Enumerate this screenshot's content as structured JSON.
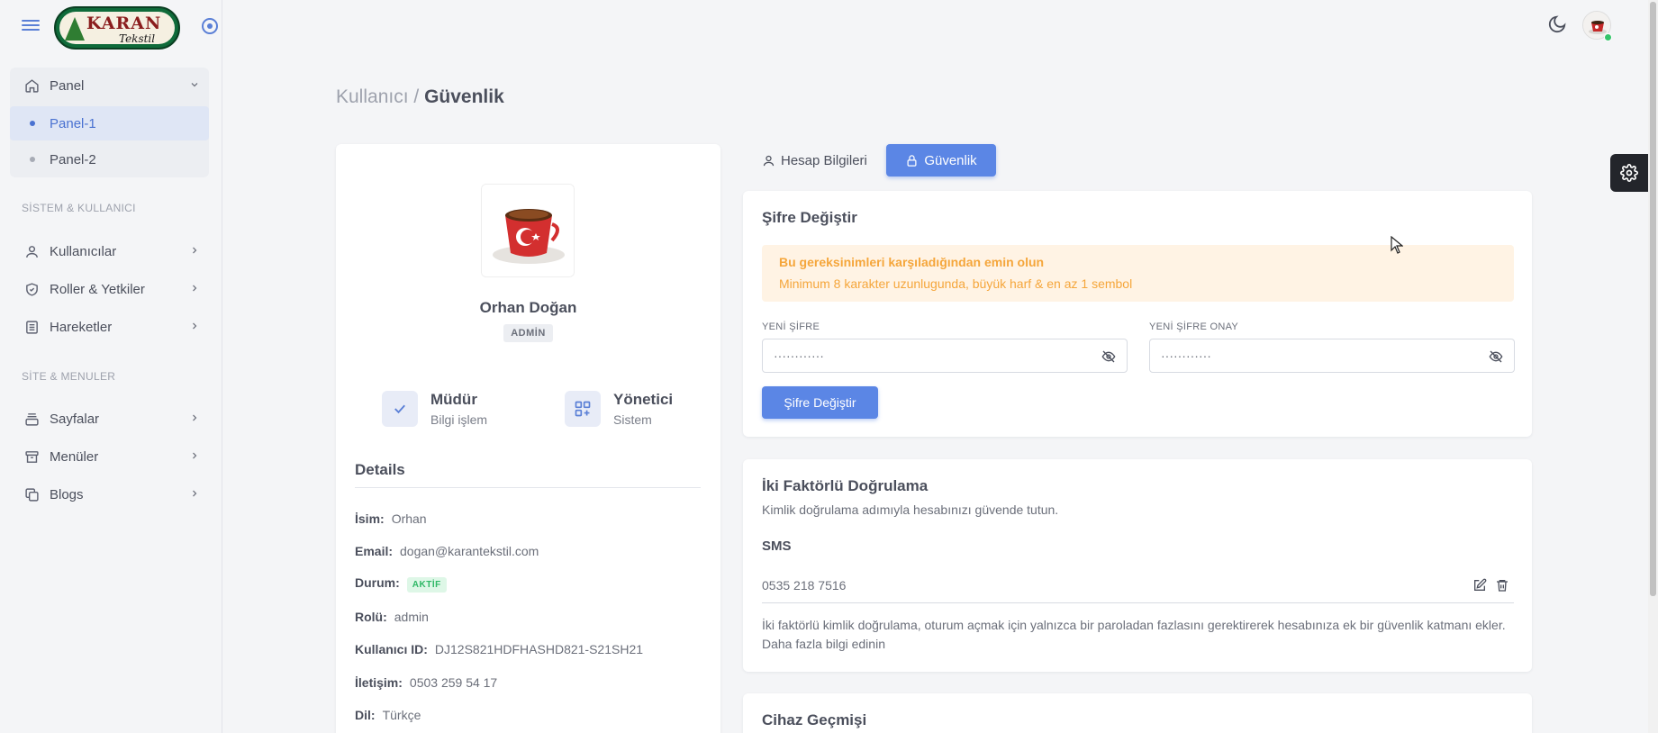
{
  "brand": {
    "logo_text": "KARAN",
    "logo_sub": "Tekstil"
  },
  "sidebar": {
    "panel": {
      "label": "Panel",
      "icon": "home-icon"
    },
    "panel_items": [
      {
        "label": "Panel-1",
        "active": true
      },
      {
        "label": "Panel-2",
        "active": false
      }
    ],
    "section_users": "SİSTEM & KULLANICI",
    "user_items": [
      {
        "label": "Kullanıcılar",
        "icon": "user-icon"
      },
      {
        "label": "Roller & Yetkiler",
        "icon": "shield-icon"
      },
      {
        "label": "Hareketler",
        "icon": "list-icon"
      }
    ],
    "section_site": "SİTE & MENULER",
    "site_items": [
      {
        "label": "Sayfalar",
        "icon": "layers-icon"
      },
      {
        "label": "Menüler",
        "icon": "archive-icon"
      },
      {
        "label": "Blogs",
        "icon": "copy-icon"
      }
    ]
  },
  "breadcrumb": {
    "parent": "Kullanıcı /",
    "current": "Güvenlik"
  },
  "profile": {
    "name": "Orhan Doğan",
    "role_badge": "ADMİN",
    "stats": [
      {
        "title": "Müdür",
        "sub": "Bilgi işlem",
        "icon": "check-icon"
      },
      {
        "title": "Yönetici",
        "sub": "Sistem",
        "icon": "grid-plus-icon"
      }
    ],
    "details_title": "Details",
    "details": [
      {
        "label": "İsim:",
        "value": "Orhan"
      },
      {
        "label": "Email:",
        "value": "dogan@karantekstil.com"
      },
      {
        "label": "Durum:",
        "value": "AKTİF"
      },
      {
        "label": "Rolü:",
        "value": "admin"
      },
      {
        "label": "Kullanıcı ID:",
        "value": "DJ12S821HDFHASHD821-S21SH21"
      },
      {
        "label": "İletişim:",
        "value": "0503 259 54 17"
      },
      {
        "label": "Dil:",
        "value": "Türkçe"
      }
    ]
  },
  "tabs": {
    "account": "Hesap Bilgileri",
    "security": "Güvenlik"
  },
  "password_card": {
    "title": "Şifre Değiştir",
    "warning_title": "Bu gereksinimleri karşıladığından emin olun",
    "warning_text": "Minimum 8 karakter uzunlugunda, büyük harf & en az 1 sembol",
    "new_password_label": "YENİ ŞİFRE",
    "new_password_value": "············",
    "confirm_password_label": "YENİ ŞİFRE ONAY",
    "confirm_password_value": "············",
    "submit_label": "Şifre Değiştir"
  },
  "tfa_card": {
    "title": "İki Faktörlü Doğrulama",
    "subtitle": "Kimlik doğrulama adımıyla hesabınızı güvende tutun.",
    "sms_label": "SMS",
    "sms_phone": "0535 218 7516",
    "note": "İki faktörlü kimlik doğrulama, oturum açmak için yalnızca bir paroladan fazlasını gerektirerek hesabınıza ek bir güvenlik katmanı ekler.",
    "note_link": "Daha fazla bilgi edinin"
  },
  "device_card": {
    "title": "Cihaz Geçmişi"
  },
  "colors": {
    "primary": "#5b86e5",
    "warning": "#f5a63b",
    "success": "#2fb866"
  }
}
